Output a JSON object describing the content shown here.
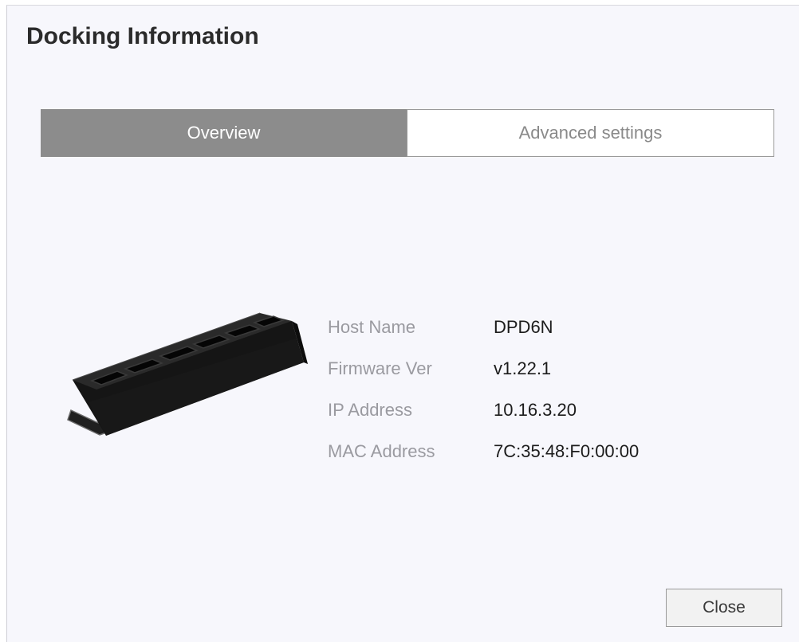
{
  "dialog": {
    "title": "Docking Information"
  },
  "tabs": [
    {
      "label": "Overview",
      "active": true
    },
    {
      "label": "Advanced settings",
      "active": false
    }
  ],
  "device_info": {
    "rows": [
      {
        "label": "Host Name",
        "value": "DPD6N"
      },
      {
        "label": "Firmware Ver",
        "value": "v1.22.1"
      },
      {
        "label": "IP Address",
        "value": "10.16.3.20"
      },
      {
        "label": "MAC Address",
        "value": "7C:35:48:F0:00:00"
      }
    ]
  },
  "footer": {
    "close_label": "Close"
  },
  "colors": {
    "dialog_background": "#f7f7fc",
    "active_tab": "#8c8c8c",
    "label_text": "#9a9aa0",
    "value_text": "#1c1c1c"
  },
  "icons": {
    "device_image": "docking-station-image"
  }
}
